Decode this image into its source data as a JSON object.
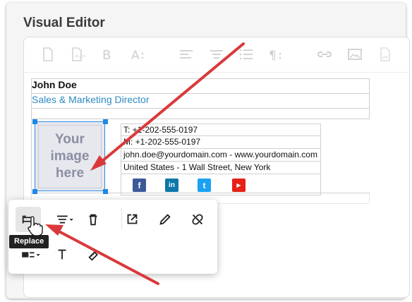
{
  "panel": {
    "title": "Visual Editor"
  },
  "toolbar": {
    "icons": [
      "new-document-icon",
      "file-code-icon",
      "bold-icon",
      "font-size-icon",
      "align-left-icon",
      "align-center-icon",
      "list-icon",
      "paragraph-icon",
      "link-icon",
      "image-icon",
      "image-file-icon"
    ]
  },
  "signature": {
    "name": "John Doe",
    "title": "Sales & Marketing Director",
    "image_placeholder": [
      "Your",
      "image",
      "here"
    ],
    "contact": [
      "T: +1-202-555-0197",
      "M: +1-202-555-0197",
      "john.doe@yourdomain.com -  www.yourdomain.com",
      "United States - 1 Wall Street, New York"
    ],
    "social": [
      {
        "name": "facebook-icon",
        "glyph": "f",
        "color": "#3b5998"
      },
      {
        "name": "linkedin-icon",
        "glyph": "in",
        "color": "#0e76a8"
      },
      {
        "name": "twitter-icon",
        "glyph": "t",
        "color": "#1da1f2"
      },
      {
        "name": "youtube-icon",
        "glyph": "▶",
        "color": "#e62117"
      }
    ]
  },
  "image_popup": {
    "tooltip": "Replace",
    "row1": [
      "replace-icon",
      "align-icon",
      "delete-icon",
      "open-link-icon",
      "edit-link-icon",
      "unlink-icon"
    ],
    "row2": [
      "display-icon",
      "alt-text-icon",
      "size-icon"
    ]
  },
  "colors": {
    "accent": "#2f8ac4",
    "arrow": "#d9393b",
    "handle": "#1e88e5"
  }
}
